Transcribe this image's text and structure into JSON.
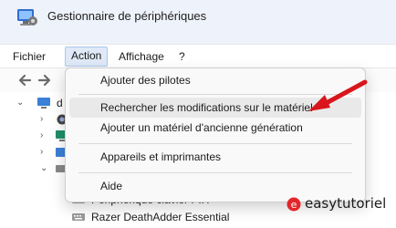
{
  "window": {
    "title": "Gestionnaire de périphériques"
  },
  "menubar": {
    "items": [
      {
        "label": "Fichier"
      },
      {
        "label": "Action"
      },
      {
        "label": "Affichage"
      },
      {
        "label": "?"
      }
    ]
  },
  "tree": {
    "root_label": "d",
    "rows": [
      {
        "label": "Périphérique clavier PIH"
      },
      {
        "label": "Razer DeathAdder Essential"
      }
    ]
  },
  "dropdown": {
    "items": [
      {
        "label": "Ajouter des pilotes"
      },
      {
        "label": "Rechercher les modifications sur le matériel"
      },
      {
        "label": "Ajouter un matériel d'ancienne génération"
      },
      {
        "label": "Appareils et imprimantes"
      },
      {
        "label": "Aide"
      }
    ]
  },
  "watermark": {
    "text": "easytutoriel"
  },
  "colors": {
    "accent": "#1a73e8",
    "arrow": "#d8161b",
    "active_menu_bg": "#dfe9f7"
  }
}
